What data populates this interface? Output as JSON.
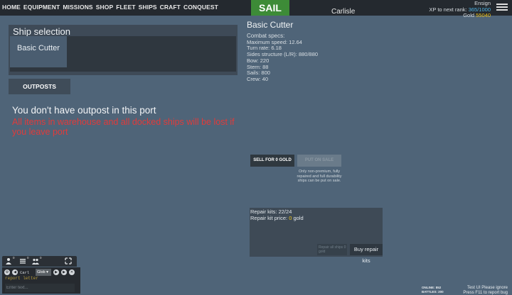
{
  "nav": [
    "HOME",
    "EQUIPMENT",
    "MISSIONS",
    "SHOP",
    "FLEET",
    "SHIPS",
    "CRAFT",
    "CONQUEST"
  ],
  "sail_label": "SAIL",
  "port_name": "Carlisle",
  "rank": {
    "title": "Ensign",
    "xp_label": "XP to next rank:",
    "xp_value": "365/1000",
    "gold_label": "Gold",
    "gold_value": "55040"
  },
  "ship_selection": {
    "title": "Ship selection",
    "items": [
      {
        "label": "Basic Cutter"
      }
    ]
  },
  "outposts_label": "OUTPOSTS",
  "no_outpost_msg": "You don't have outpost in this port",
  "warning_msg": "All items in warehouse and all docked ships will be lost if you leave port",
  "ship_detail": {
    "name": "Basic Cutter",
    "specs_title": "Combat specs:",
    "specs": [
      "Maximum speed: 12.64",
      "Turn rate: 6.18",
      "Sides structure (L/R): 880/880",
      "Bow: 220",
      "Stern: 88",
      "Sails: 800",
      "Crew: 40"
    ]
  },
  "sell_label": "SELL FOR 0 GOLD",
  "put_sale_label": "PUT ON SALE",
  "sale_note": "Only non-premium, fully repaired and full durability ships can be put on sale.",
  "repair": {
    "kits_text": "Repair kits: 22/24",
    "price_label": "Repair kit price: ",
    "price_value": "0",
    "price_unit": " gold",
    "dark_text": "Repair all ships 0 gold",
    "buy_label": "Buy repair kits"
  },
  "chat": {
    "badges": [
      "0",
      "0",
      "0"
    ],
    "name": "Carl",
    "channel": "Glob",
    "message": "report letter",
    "input_placeholder": "Enter text..."
  },
  "online": {
    "online_label": "ONLINE: 852",
    "battles_label": "BATTLES: 200"
  },
  "test_note": {
    "line1": "Test UI Please ignore",
    "line2": "Press F11 to report bug"
  },
  "colors": {
    "background": "#4f6478",
    "topbar": "#24292f",
    "sail": "#3d8b37",
    "warning": "#e03b3b",
    "xp": "#4fb6e8",
    "gold": "#f0c419"
  },
  "icons": [
    "menu-icon",
    "user-icon",
    "list-icon",
    "group-icon",
    "expand-icon",
    "settings-icon",
    "arrow-left-icon",
    "arrow-right-icon",
    "close-icon"
  ]
}
